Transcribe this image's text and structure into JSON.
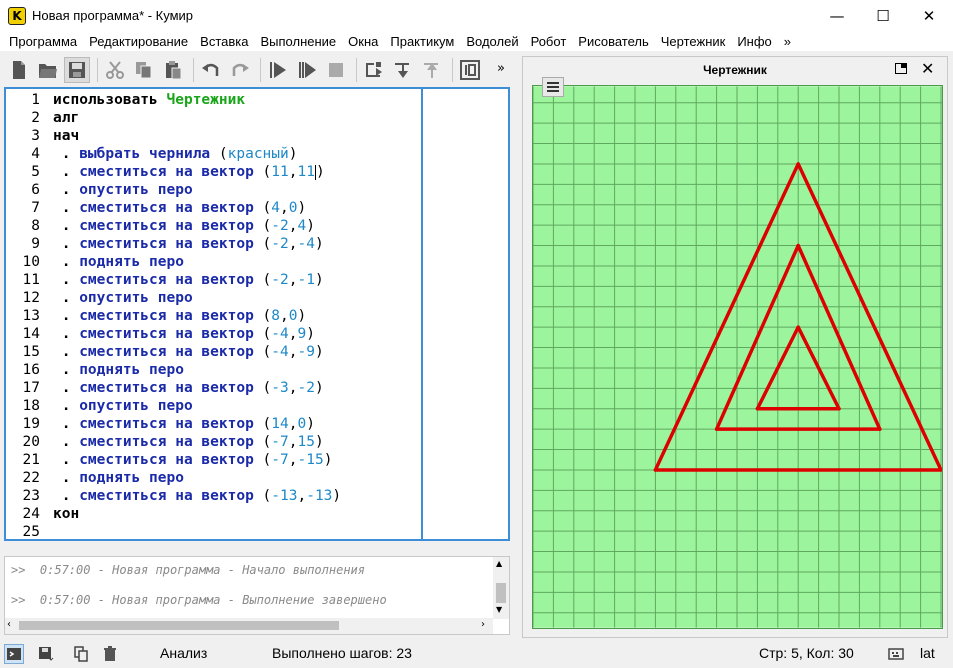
{
  "window": {
    "icon_letter": "K",
    "title": "Новая программа* - Кумир",
    "minimize": "—",
    "maximize": "☐",
    "close": "✕"
  },
  "menu": {
    "items": [
      "Программа",
      "Редактирование",
      "Вставка",
      "Выполнение",
      "Окна",
      "Практикум",
      "Водолей",
      "Робот",
      "Рисователь",
      "Чертежник",
      "Инфо",
      "»"
    ]
  },
  "toolbar": {
    "icons": [
      "new-file-icon",
      "open-folder-icon",
      "save-icon",
      "cut-icon",
      "copy-icon",
      "paste-icon",
      "undo-icon",
      "redo-icon",
      "run-icon",
      "run-steps-icon",
      "stop-icon",
      "step-over-icon",
      "step-into-icon",
      "step-out-icon",
      "variables-icon"
    ],
    "overflow": "»"
  },
  "editor": {
    "line_numbers": [
      "1",
      "2",
      "3",
      "4",
      "5",
      "6",
      "7",
      "8",
      "9",
      "10",
      "11",
      "12",
      "13",
      "14",
      "15",
      "16",
      "17",
      "18",
      "19",
      "20",
      "21",
      "22",
      "23",
      "24",
      "25"
    ],
    "lines": [
      {
        "kind": "use",
        "kw": "использовать",
        "name": "Чертежник"
      },
      {
        "kind": "kw",
        "text": "алг"
      },
      {
        "kind": "kw",
        "text": "нач"
      },
      {
        "kind": "cmd",
        "cmd": "выбрать чернила",
        "args": [],
        "str": "красный"
      },
      {
        "kind": "cmd",
        "cmd": "сместиться на вектор",
        "args": [
          "11",
          "11"
        ],
        "cursor": true
      },
      {
        "kind": "cmd",
        "cmd": "опустить перо"
      },
      {
        "kind": "cmd",
        "cmd": "сместиться на вектор",
        "args": [
          "4",
          "0"
        ]
      },
      {
        "kind": "cmd",
        "cmd": "сместиться на вектор",
        "args": [
          "-2",
          "4"
        ]
      },
      {
        "kind": "cmd",
        "cmd": "сместиться на вектор",
        "args": [
          "-2",
          "-4"
        ]
      },
      {
        "kind": "cmd",
        "cmd": "поднять перо"
      },
      {
        "kind": "cmd",
        "cmd": "сместиться на вектор",
        "args": [
          "-2",
          "-1"
        ]
      },
      {
        "kind": "cmd",
        "cmd": "опустить перо"
      },
      {
        "kind": "cmd",
        "cmd": "сместиться на вектор",
        "args": [
          "8",
          "0"
        ]
      },
      {
        "kind": "cmd",
        "cmd": "сместиться на вектор",
        "args": [
          "-4",
          "9"
        ]
      },
      {
        "kind": "cmd",
        "cmd": "сместиться на вектор",
        "args": [
          "-4",
          "-9"
        ]
      },
      {
        "kind": "cmd",
        "cmd": "поднять перо"
      },
      {
        "kind": "cmd",
        "cmd": "сместиться на вектор",
        "args": [
          "-3",
          "-2"
        ]
      },
      {
        "kind": "cmd",
        "cmd": "опустить перо"
      },
      {
        "kind": "cmd",
        "cmd": "сместиться на вектор",
        "args": [
          "14",
          "0"
        ]
      },
      {
        "kind": "cmd",
        "cmd": "сместиться на вектор",
        "args": [
          "-7",
          "15"
        ]
      },
      {
        "kind": "cmd",
        "cmd": "сместиться на вектор",
        "args": [
          "-7",
          "-15"
        ]
      },
      {
        "kind": "cmd",
        "cmd": "поднять перо"
      },
      {
        "kind": "cmd",
        "cmd": "сместиться на вектор",
        "args": [
          "-13",
          "-13"
        ]
      },
      {
        "kind": "kw",
        "text": "кон"
      },
      {
        "kind": "empty"
      }
    ]
  },
  "console": {
    "lines": [
      ">>  0:57:00 - Новая программа - Начало выполнения",
      ">>  0:57:00 - Новая программа - Выполнение завершено"
    ]
  },
  "drawer": {
    "title": "Чертежник",
    "pen_color": "#dd0000",
    "field_color": "#9cf59c",
    "grid_color": "#5fa85f",
    "segments": [
      {
        "from": [
          11,
          11
        ],
        "to": [
          15,
          11
        ]
      },
      {
        "from": [
          15,
          11
        ],
        "to": [
          13,
          15
        ]
      },
      {
        "from": [
          13,
          15
        ],
        "to": [
          11,
          11
        ]
      },
      {
        "from": [
          9,
          10
        ],
        "to": [
          17,
          10
        ]
      },
      {
        "from": [
          17,
          10
        ],
        "to": [
          13,
          19
        ]
      },
      {
        "from": [
          13,
          19
        ],
        "to": [
          9,
          10
        ]
      },
      {
        "from": [
          6,
          8
        ],
        "to": [
          20,
          8
        ]
      },
      {
        "from": [
          20,
          8
        ],
        "to": [
          13,
          23
        ]
      },
      {
        "from": [
          13,
          23
        ],
        "to": [
          6,
          8
        ]
      }
    ]
  },
  "status": {
    "analysis": "Анализ",
    "steps": "Выполнено шагов: 23",
    "position": "Стр: 5, Кол: 30",
    "layout": "lat"
  }
}
